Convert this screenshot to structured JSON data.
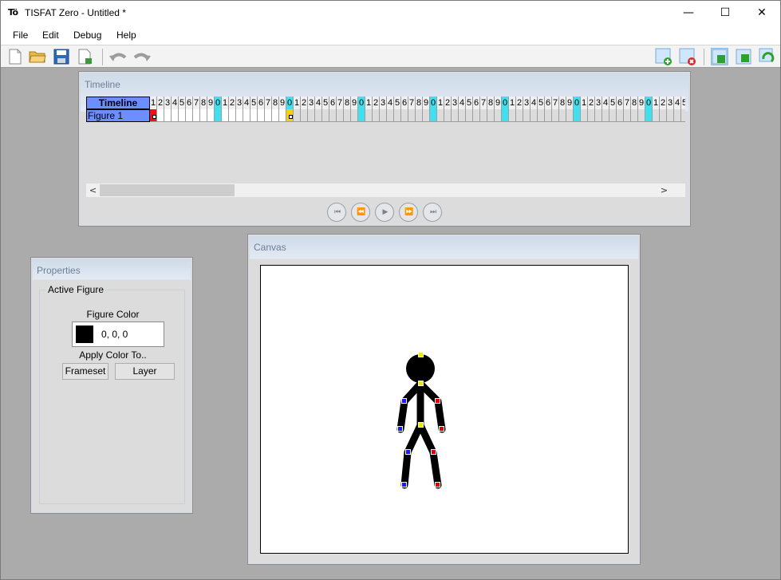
{
  "window": {
    "app_icon": "Tö",
    "title": "TISFAT Zero - Untitled *",
    "controls": {
      "minimize": "—",
      "maximize": "☐",
      "close": "✕"
    }
  },
  "menu": [
    "File",
    "Edit",
    "Debug",
    "Help"
  ],
  "toolbar": {
    "icons": [
      "new-file-icon",
      "open-folder-icon",
      "save-icon",
      "export-icon",
      "undo-icon",
      "redo-icon",
      "add-figure-icon",
      "remove-figure-icon",
      "move-layer-down-icon",
      "move-layer-up-icon",
      "refresh-icon"
    ]
  },
  "timeline": {
    "title": "Timeline",
    "header_label": "Timeline",
    "layers": [
      "Figure 1"
    ],
    "frame_numbers": [
      "1",
      "2",
      "3",
      "4",
      "5",
      "6",
      "7",
      "8",
      "9",
      "0",
      "1",
      "2",
      "3",
      "4",
      "5",
      "6",
      "7",
      "8",
      "9",
      "0",
      "1",
      "2",
      "3",
      "4",
      "5",
      "6",
      "7",
      "8",
      "9",
      "0",
      "1",
      "2",
      "3",
      "4",
      "5",
      "6",
      "7",
      "8",
      "9",
      "0",
      "1",
      "2",
      "3",
      "4",
      "5",
      "6",
      "7",
      "8",
      "9",
      "0",
      "1",
      "2",
      "3",
      "4",
      "5",
      "6",
      "7",
      "8",
      "9",
      "0",
      "1",
      "2",
      "3",
      "4",
      "5",
      "6",
      "7",
      "8",
      "9",
      "0",
      "1",
      "2",
      "3",
      "4",
      "5",
      "6",
      "7",
      "8",
      "9",
      "0",
      "1",
      "2",
      "3",
      "4",
      "5"
    ],
    "keyframes": {
      "start": 1,
      "end": 20
    },
    "scroll_left": "<",
    "scroll_right": ">",
    "playback": [
      "⏮",
      "⏪",
      "▶",
      "⏩",
      "⏭"
    ]
  },
  "properties": {
    "title": "Properties",
    "group_label": "Active Figure",
    "figure_color_label": "Figure Color",
    "color_value": "0, 0, 0",
    "color_hex": "#000000",
    "apply_label": "Apply Color To..",
    "buttons": {
      "frameset": "Frameset",
      "layer": "Layer"
    }
  },
  "canvas": {
    "title": "Canvas"
  },
  "colors": {
    "accent": "#6c8fff",
    "highlight": "#3fe0f0",
    "keyframe_start": "#e11111",
    "keyframe_end": "#f5d200"
  }
}
